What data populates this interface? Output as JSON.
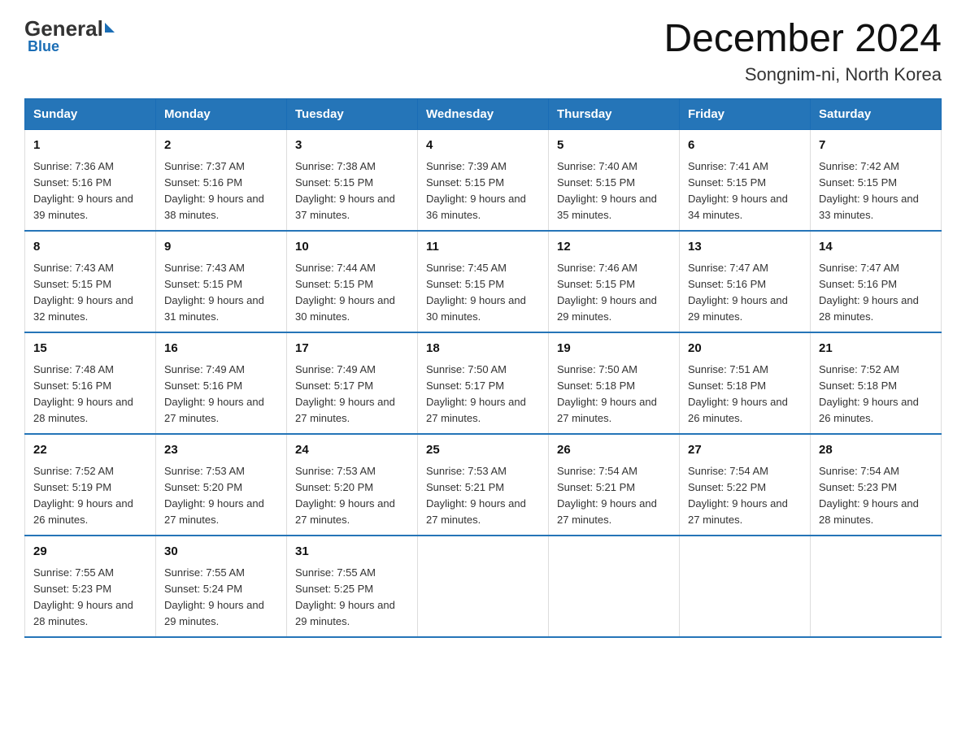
{
  "logo": {
    "general": "General",
    "arrow": "▶",
    "blue": "Blue"
  },
  "title": "December 2024",
  "subtitle": "Songnim-ni, North Korea",
  "weekdays": [
    "Sunday",
    "Monday",
    "Tuesday",
    "Wednesday",
    "Thursday",
    "Friday",
    "Saturday"
  ],
  "weeks": [
    [
      {
        "day": "1",
        "sunrise": "7:36 AM",
        "sunset": "5:16 PM",
        "daylight": "9 hours and 39 minutes."
      },
      {
        "day": "2",
        "sunrise": "7:37 AM",
        "sunset": "5:16 PM",
        "daylight": "9 hours and 38 minutes."
      },
      {
        "day": "3",
        "sunrise": "7:38 AM",
        "sunset": "5:15 PM",
        "daylight": "9 hours and 37 minutes."
      },
      {
        "day": "4",
        "sunrise": "7:39 AM",
        "sunset": "5:15 PM",
        "daylight": "9 hours and 36 minutes."
      },
      {
        "day": "5",
        "sunrise": "7:40 AM",
        "sunset": "5:15 PM",
        "daylight": "9 hours and 35 minutes."
      },
      {
        "day": "6",
        "sunrise": "7:41 AM",
        "sunset": "5:15 PM",
        "daylight": "9 hours and 34 minutes."
      },
      {
        "day": "7",
        "sunrise": "7:42 AM",
        "sunset": "5:15 PM",
        "daylight": "9 hours and 33 minutes."
      }
    ],
    [
      {
        "day": "8",
        "sunrise": "7:43 AM",
        "sunset": "5:15 PM",
        "daylight": "9 hours and 32 minutes."
      },
      {
        "day": "9",
        "sunrise": "7:43 AM",
        "sunset": "5:15 PM",
        "daylight": "9 hours and 31 minutes."
      },
      {
        "day": "10",
        "sunrise": "7:44 AM",
        "sunset": "5:15 PM",
        "daylight": "9 hours and 30 minutes."
      },
      {
        "day": "11",
        "sunrise": "7:45 AM",
        "sunset": "5:15 PM",
        "daylight": "9 hours and 30 minutes."
      },
      {
        "day": "12",
        "sunrise": "7:46 AM",
        "sunset": "5:15 PM",
        "daylight": "9 hours and 29 minutes."
      },
      {
        "day": "13",
        "sunrise": "7:47 AM",
        "sunset": "5:16 PM",
        "daylight": "9 hours and 29 minutes."
      },
      {
        "day": "14",
        "sunrise": "7:47 AM",
        "sunset": "5:16 PM",
        "daylight": "9 hours and 28 minutes."
      }
    ],
    [
      {
        "day": "15",
        "sunrise": "7:48 AM",
        "sunset": "5:16 PM",
        "daylight": "9 hours and 28 minutes."
      },
      {
        "day": "16",
        "sunrise": "7:49 AM",
        "sunset": "5:16 PM",
        "daylight": "9 hours and 27 minutes."
      },
      {
        "day": "17",
        "sunrise": "7:49 AM",
        "sunset": "5:17 PM",
        "daylight": "9 hours and 27 minutes."
      },
      {
        "day": "18",
        "sunrise": "7:50 AM",
        "sunset": "5:17 PM",
        "daylight": "9 hours and 27 minutes."
      },
      {
        "day": "19",
        "sunrise": "7:50 AM",
        "sunset": "5:18 PM",
        "daylight": "9 hours and 27 minutes."
      },
      {
        "day": "20",
        "sunrise": "7:51 AM",
        "sunset": "5:18 PM",
        "daylight": "9 hours and 26 minutes."
      },
      {
        "day": "21",
        "sunrise": "7:52 AM",
        "sunset": "5:18 PM",
        "daylight": "9 hours and 26 minutes."
      }
    ],
    [
      {
        "day": "22",
        "sunrise": "7:52 AM",
        "sunset": "5:19 PM",
        "daylight": "9 hours and 26 minutes."
      },
      {
        "day": "23",
        "sunrise": "7:53 AM",
        "sunset": "5:20 PM",
        "daylight": "9 hours and 27 minutes."
      },
      {
        "day": "24",
        "sunrise": "7:53 AM",
        "sunset": "5:20 PM",
        "daylight": "9 hours and 27 minutes."
      },
      {
        "day": "25",
        "sunrise": "7:53 AM",
        "sunset": "5:21 PM",
        "daylight": "9 hours and 27 minutes."
      },
      {
        "day": "26",
        "sunrise": "7:54 AM",
        "sunset": "5:21 PM",
        "daylight": "9 hours and 27 minutes."
      },
      {
        "day": "27",
        "sunrise": "7:54 AM",
        "sunset": "5:22 PM",
        "daylight": "9 hours and 27 minutes."
      },
      {
        "day": "28",
        "sunrise": "7:54 AM",
        "sunset": "5:23 PM",
        "daylight": "9 hours and 28 minutes."
      }
    ],
    [
      {
        "day": "29",
        "sunrise": "7:55 AM",
        "sunset": "5:23 PM",
        "daylight": "9 hours and 28 minutes."
      },
      {
        "day": "30",
        "sunrise": "7:55 AM",
        "sunset": "5:24 PM",
        "daylight": "9 hours and 29 minutes."
      },
      {
        "day": "31",
        "sunrise": "7:55 AM",
        "sunset": "5:25 PM",
        "daylight": "9 hours and 29 minutes."
      },
      null,
      null,
      null,
      null
    ]
  ]
}
